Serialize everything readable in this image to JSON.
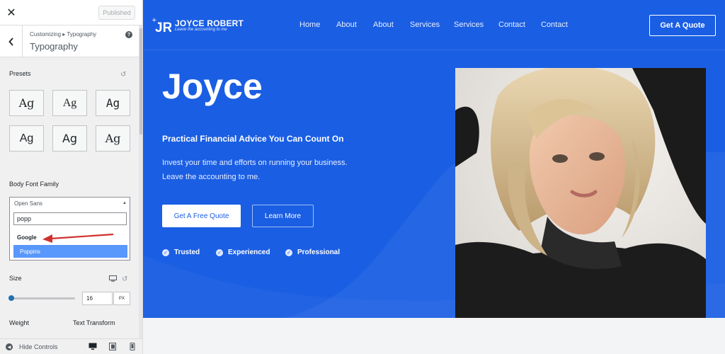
{
  "customizer": {
    "close_glyph": "✕",
    "publish_label": "Published",
    "breadcrumb": "Customizing ▸ Typography",
    "section_title": "Typography",
    "help_glyph": "?",
    "presets_label": "Presets",
    "presets": [
      "Ag",
      "Ag",
      "Ag",
      "Ag",
      "Ag",
      "Ag"
    ],
    "body_font_label": "Body Font Family",
    "font_select": {
      "selected": "Open Sans",
      "search_value": "popp",
      "group_label": "Google",
      "highlighted_option": "Poppins"
    },
    "size_label": "Size",
    "size_value": "16",
    "size_unit": "PX",
    "size_slider_value_fraction": 0.03,
    "weight_label": "Weight",
    "text_transform_label": "Text Transform",
    "hide_controls_label": "Hide Controls",
    "icons": [
      "close-icon",
      "back-arrow-icon",
      "help-icon",
      "reset-icon",
      "desktop-icon",
      "tablet-icon",
      "mobile-icon",
      "collapse-icon"
    ]
  },
  "site": {
    "logo_name": "JOYCE ROBERT",
    "logo_tagline": "Leave the accounting to me",
    "nav": [
      "Home",
      "About",
      "About",
      "Services",
      "Services",
      "Contact",
      "Contact"
    ],
    "cta_label": "Get A Quote",
    "hero_title": "Joyce",
    "hero_subtitle": "Practical Financial Advice You Can Count On",
    "hero_desc_1": "Invest your time and efforts on running your business.",
    "hero_desc_2": "Leave the accounting to me.",
    "btn_primary": "Get A Free Quote",
    "btn_secondary": "Learn More",
    "features": [
      "Trusted",
      "Experienced",
      "Professional"
    ],
    "colors": {
      "hero_blue": "#1a5ee3",
      "select_highlight": "#5897fb",
      "wp_accent": "#2271b1",
      "arrow_red": "#d0312d"
    }
  }
}
